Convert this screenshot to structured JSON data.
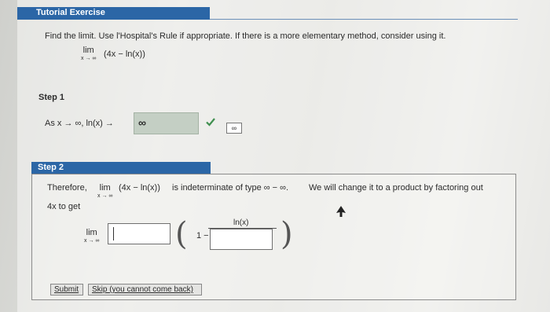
{
  "header": {
    "title": "Tutorial Exercise"
  },
  "question": {
    "text": "Find the limit. Use l'Hospital's Rule if appropriate. If there is a more elementary method, consider using it.",
    "lim_word": "lim",
    "lim_sub": "x → ∞",
    "expression": "(4x − ln(x))"
  },
  "step1": {
    "label": "Step 1",
    "text": "As x → ∞, ln(x) →",
    "answer": "∞",
    "check_icon": "checkmark-icon",
    "keyboard_label": "∞"
  },
  "step2": {
    "label": "Step 2",
    "text_a": "Therefore,",
    "lim_word": "lim",
    "lim_sub": "x → ∞",
    "text_b": "(4x − ln(x))",
    "text_c": "is indeterminate of type ∞ − ∞.",
    "text_d": "We will change it to a product by factoring out",
    "text_e": "4x to get",
    "one": "1 −",
    "numerator": "ln(x)",
    "input_a_value": "",
    "input_b_value": ""
  },
  "buttons": {
    "submit": "Submit",
    "skip": "Skip (you cannot come back)"
  },
  "colors": {
    "header_bg": "#2b66a6",
    "answer_bg": "#c4cfc4",
    "check": "#3f8f4f"
  }
}
